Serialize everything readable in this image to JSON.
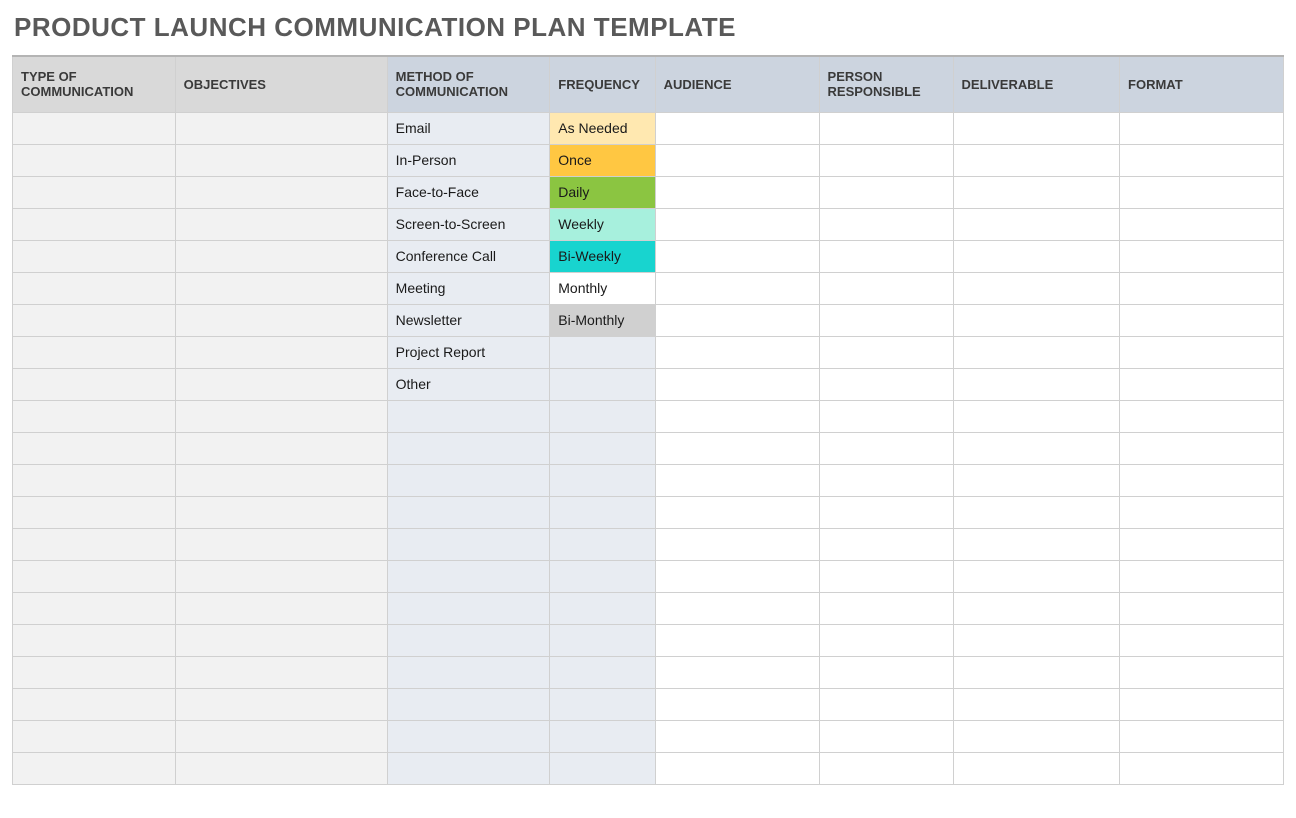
{
  "title": "PRODUCT LAUNCH COMMUNICATION PLAN TEMPLATE",
  "headers": {
    "type": "TYPE OF COMMUNICATION",
    "objectives": "OBJECTIVES",
    "method": "METHOD OF COMMUNICATION",
    "frequency": "FREQUENCY",
    "audience": "AUDIENCE",
    "person": "PERSON RESPONSIBLE",
    "deliverable": "DELIVERABLE",
    "format": "FORMAT"
  },
  "rows": [
    {
      "type": "",
      "objectives": "",
      "method": "Email",
      "frequency": "As Needed",
      "freqClass": "freq-asneeded",
      "audience": "",
      "person": "",
      "deliverable": "",
      "format": ""
    },
    {
      "type": "",
      "objectives": "",
      "method": "In-Person",
      "frequency": "Once",
      "freqClass": "freq-once",
      "audience": "",
      "person": "",
      "deliverable": "",
      "format": ""
    },
    {
      "type": "",
      "objectives": "",
      "method": "Face-to-Face",
      "frequency": "Daily",
      "freqClass": "freq-daily",
      "audience": "",
      "person": "",
      "deliverable": "",
      "format": ""
    },
    {
      "type": "",
      "objectives": "",
      "method": "Screen-to-Screen",
      "frequency": "Weekly",
      "freqClass": "freq-weekly",
      "audience": "",
      "person": "",
      "deliverable": "",
      "format": ""
    },
    {
      "type": "",
      "objectives": "",
      "method": "Conference Call",
      "frequency": "Bi-Weekly",
      "freqClass": "freq-biweekly",
      "audience": "",
      "person": "",
      "deliverable": "",
      "format": ""
    },
    {
      "type": "",
      "objectives": "",
      "method": "Meeting",
      "frequency": "Monthly",
      "freqClass": "freq-monthly",
      "audience": "",
      "person": "",
      "deliverable": "",
      "format": ""
    },
    {
      "type": "",
      "objectives": "",
      "method": "Newsletter",
      "frequency": "Bi-Monthly",
      "freqClass": "freq-bimonthly",
      "audience": "",
      "person": "",
      "deliverable": "",
      "format": ""
    },
    {
      "type": "",
      "objectives": "",
      "method": "Project Report",
      "frequency": "",
      "freqClass": "",
      "audience": "",
      "person": "",
      "deliverable": "",
      "format": ""
    },
    {
      "type": "",
      "objectives": "",
      "method": "Other",
      "frequency": "",
      "freqClass": "",
      "audience": "",
      "person": "",
      "deliverable": "",
      "format": ""
    },
    {
      "type": "",
      "objectives": "",
      "method": "",
      "frequency": "",
      "freqClass": "",
      "audience": "",
      "person": "",
      "deliverable": "",
      "format": ""
    },
    {
      "type": "",
      "objectives": "",
      "method": "",
      "frequency": "",
      "freqClass": "",
      "audience": "",
      "person": "",
      "deliverable": "",
      "format": ""
    },
    {
      "type": "",
      "objectives": "",
      "method": "",
      "frequency": "",
      "freqClass": "",
      "audience": "",
      "person": "",
      "deliverable": "",
      "format": ""
    },
    {
      "type": "",
      "objectives": "",
      "method": "",
      "frequency": "",
      "freqClass": "",
      "audience": "",
      "person": "",
      "deliverable": "",
      "format": ""
    },
    {
      "type": "",
      "objectives": "",
      "method": "",
      "frequency": "",
      "freqClass": "",
      "audience": "",
      "person": "",
      "deliverable": "",
      "format": ""
    },
    {
      "type": "",
      "objectives": "",
      "method": "",
      "frequency": "",
      "freqClass": "",
      "audience": "",
      "person": "",
      "deliverable": "",
      "format": ""
    },
    {
      "type": "",
      "objectives": "",
      "method": "",
      "frequency": "",
      "freqClass": "",
      "audience": "",
      "person": "",
      "deliverable": "",
      "format": ""
    },
    {
      "type": "",
      "objectives": "",
      "method": "",
      "frequency": "",
      "freqClass": "",
      "audience": "",
      "person": "",
      "deliverable": "",
      "format": ""
    },
    {
      "type": "",
      "objectives": "",
      "method": "",
      "frequency": "",
      "freqClass": "",
      "audience": "",
      "person": "",
      "deliverable": "",
      "format": ""
    },
    {
      "type": "",
      "objectives": "",
      "method": "",
      "frequency": "",
      "freqClass": "",
      "audience": "",
      "person": "",
      "deliverable": "",
      "format": ""
    },
    {
      "type": "",
      "objectives": "",
      "method": "",
      "frequency": "",
      "freqClass": "",
      "audience": "",
      "person": "",
      "deliverable": "",
      "format": ""
    },
    {
      "type": "",
      "objectives": "",
      "method": "",
      "frequency": "",
      "freqClass": "",
      "audience": "",
      "person": "",
      "deliverable": "",
      "format": ""
    }
  ]
}
